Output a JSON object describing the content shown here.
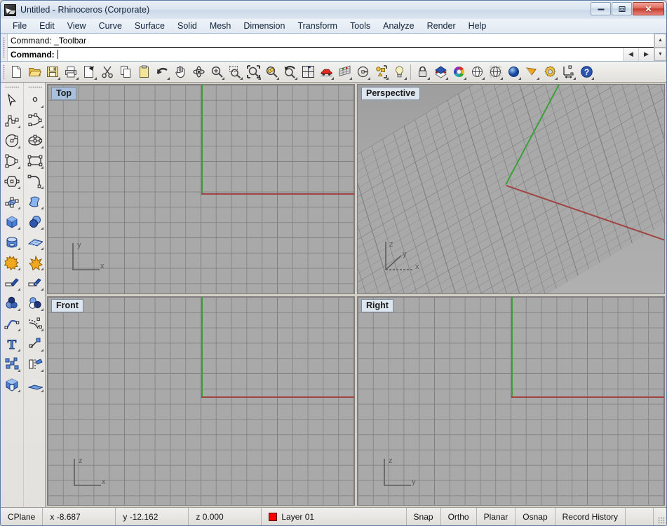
{
  "window": {
    "title": "Untitled - Rhinoceros (Corporate)",
    "icon": "rhino-logo-icon",
    "controls": [
      {
        "name": "minimize-button",
        "label": "–"
      },
      {
        "name": "restore-button",
        "label": "❐"
      },
      {
        "name": "close-button",
        "label": "✕"
      }
    ]
  },
  "menubar": {
    "items": [
      {
        "label": "File"
      },
      {
        "label": "Edit"
      },
      {
        "label": "View"
      },
      {
        "label": "Curve"
      },
      {
        "label": "Surface"
      },
      {
        "label": "Solid"
      },
      {
        "label": "Mesh"
      },
      {
        "label": "Dimension"
      },
      {
        "label": "Transform"
      },
      {
        "label": "Tools"
      },
      {
        "label": "Analyze"
      },
      {
        "label": "Render"
      },
      {
        "label": "Help"
      }
    ]
  },
  "command_area": {
    "history_line": "Command: _Toolbar",
    "prompt_label": "Command:",
    "input_value": "",
    "scroll_up": "▲",
    "scroll_down": "▼",
    "nav_prev": "◀",
    "nav_next": "▶"
  },
  "toolbar": {
    "buttons": [
      {
        "name": "new-file-icon",
        "tip": "New"
      },
      {
        "name": "open-file-icon",
        "tip": "Open"
      },
      {
        "name": "save-file-icon",
        "tip": "Save"
      },
      {
        "name": "print-icon",
        "tip": "Print"
      },
      {
        "name": "print-setup-icon",
        "tip": "Print Setup"
      },
      {
        "name": "cut-icon",
        "tip": "Cut"
      },
      {
        "name": "copy-icon",
        "tip": "Copy"
      },
      {
        "name": "paste-icon",
        "tip": "Paste"
      },
      {
        "name": "undo-icon",
        "tip": "Undo"
      },
      {
        "name": "pan-hand-icon",
        "tip": "Pan"
      },
      {
        "name": "rotate-view-icon",
        "tip": "Rotate View"
      },
      {
        "name": "zoom-in-icon",
        "tip": "Zoom In"
      },
      {
        "name": "zoom-window-icon",
        "tip": "Zoom Window"
      },
      {
        "name": "zoom-extents-icon",
        "tip": "Zoom Extents"
      },
      {
        "name": "zoom-selected-icon",
        "tip": "Zoom Selected"
      },
      {
        "name": "zoom-previous-icon",
        "tip": "Zoom Previous"
      },
      {
        "name": "viewport-layout-icon",
        "tip": "Viewport Layout"
      },
      {
        "name": "named-view-car-icon",
        "tip": "Named Views"
      },
      {
        "name": "grid-settings-icon",
        "tip": "Grid Settings"
      },
      {
        "name": "select-objects-icon",
        "tip": "Select Objects"
      },
      {
        "name": "group-objects-icon",
        "tip": "Group"
      },
      {
        "name": "light-bulb-icon",
        "tip": "Lights"
      },
      {
        "name": "lock-object-icon",
        "tip": "Lock"
      },
      {
        "name": "layers-icon",
        "tip": "Layers"
      },
      {
        "name": "color-wheel-icon",
        "tip": "Object Color"
      },
      {
        "name": "wireframe-display-icon",
        "tip": "Wireframe"
      },
      {
        "name": "ghosted-display-icon",
        "tip": "Ghosted"
      },
      {
        "name": "shaded-display-icon",
        "tip": "Shaded"
      },
      {
        "name": "rendered-display-icon",
        "tip": "Rendered"
      },
      {
        "name": "options-gear-icon",
        "tip": "Options"
      },
      {
        "name": "dimension-icon",
        "tip": "Dimension"
      },
      {
        "name": "help-icon",
        "tip": "Help"
      }
    ]
  },
  "palette": {
    "rows": [
      [
        {
          "name": "select-arrow-icon"
        },
        {
          "name": "point-icon"
        }
      ],
      [
        {
          "name": "polyline-icon"
        },
        {
          "name": "curve-control-points-icon"
        }
      ],
      [
        {
          "name": "circle-icon"
        },
        {
          "name": "ellipse-icon"
        }
      ],
      [
        {
          "name": "arc-icon"
        },
        {
          "name": "rectangle-icon"
        }
      ],
      [
        {
          "name": "polygon-icon"
        },
        {
          "name": "fillet-curve-icon"
        }
      ],
      [
        {
          "name": "surface-from-points-icon"
        },
        {
          "name": "extrude-surface-icon"
        }
      ],
      [
        {
          "name": "box-solid-icon"
        },
        {
          "name": "boolean-spheres-icon"
        }
      ],
      [
        {
          "name": "cylinder-icon"
        },
        {
          "name": "mesh-plane-icon"
        }
      ],
      [
        {
          "name": "boolean-union-icon"
        },
        {
          "name": "explode-icon"
        }
      ],
      [
        {
          "name": "trim-icon"
        },
        {
          "name": "split-icon"
        }
      ],
      [
        {
          "name": "boolean-difference-icon"
        },
        {
          "name": "boolean-intersection-icon"
        }
      ],
      [
        {
          "name": "blend-curve-icon"
        },
        {
          "name": "offset-curve-icon"
        }
      ],
      [
        {
          "name": "text-tool-icon"
        },
        {
          "name": "scale-icon"
        }
      ],
      [
        {
          "name": "array-icon"
        },
        {
          "name": "mirror-icon"
        }
      ],
      [
        {
          "name": "cap-solid-icon"
        },
        {
          "name": "extrude-array-icon"
        }
      ]
    ]
  },
  "viewports": [
    {
      "name": "viewport-top",
      "label": "Top",
      "active": true,
      "projection": "ortho",
      "axes": [
        {
          "label": "y",
          "dir": "up"
        },
        {
          "label": "x",
          "dir": "right"
        }
      ]
    },
    {
      "name": "viewport-perspective",
      "label": "Perspective",
      "active": false,
      "projection": "perspective",
      "axes": [
        {
          "label": "z",
          "dir": "up"
        },
        {
          "label": "y",
          "dir": "diagonal"
        },
        {
          "label": "x",
          "dir": "right"
        }
      ]
    },
    {
      "name": "viewport-front",
      "label": "Front",
      "active": false,
      "projection": "ortho",
      "axes": [
        {
          "label": "z",
          "dir": "up"
        },
        {
          "label": "x",
          "dir": "right"
        }
      ]
    },
    {
      "name": "viewport-right",
      "label": "Right",
      "active": false,
      "projection": "ortho",
      "axes": [
        {
          "label": "z",
          "dir": "up"
        },
        {
          "label": "y",
          "dir": "right"
        }
      ]
    }
  ],
  "statusbar": {
    "cplane_label": "CPlane",
    "coord_x": "x -8.687",
    "coord_y": "y -12.162",
    "coord_z": "z 0.000",
    "layer_name": "Layer 01",
    "layer_color": "#ff0000",
    "toggles": [
      {
        "label": "Snap"
      },
      {
        "label": "Ortho"
      },
      {
        "label": "Planar"
      },
      {
        "label": "Osnap"
      },
      {
        "label": "Record History"
      }
    ]
  },
  "colors": {
    "axis_x": "#a04444",
    "axis_y": "#3aa03a",
    "viewport_bg": "#a9a9a9",
    "active_title_bg": "#a8c0dc"
  }
}
